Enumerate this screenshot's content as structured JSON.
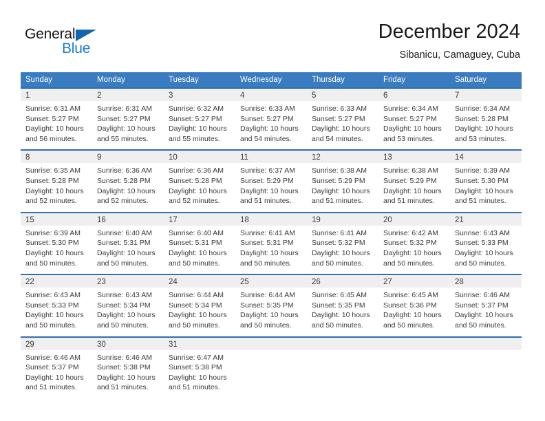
{
  "brand": {
    "name_dark": "General",
    "name_blue": "Blue",
    "accent_color": "#1a7ad4",
    "triangle_color": "#1265b0"
  },
  "header": {
    "title": "December 2024",
    "subtitle": "Sibanicu, Camaguey, Cuba"
  },
  "calendar": {
    "header_bg": "#3a7cc0",
    "row_divider_color": "#2d6fb3",
    "daynum_bg": "#efefef",
    "weekday_headers": [
      "Sunday",
      "Monday",
      "Tuesday",
      "Wednesday",
      "Thursday",
      "Friday",
      "Saturday"
    ],
    "weeks": [
      [
        {
          "day": "1",
          "sunrise": "Sunrise: 6:31 AM",
          "sunset": "Sunset: 5:27 PM",
          "daylight": "Daylight: 10 hours and 56 minutes."
        },
        {
          "day": "2",
          "sunrise": "Sunrise: 6:31 AM",
          "sunset": "Sunset: 5:27 PM",
          "daylight": "Daylight: 10 hours and 55 minutes."
        },
        {
          "day": "3",
          "sunrise": "Sunrise: 6:32 AM",
          "sunset": "Sunset: 5:27 PM",
          "daylight": "Daylight: 10 hours and 55 minutes."
        },
        {
          "day": "4",
          "sunrise": "Sunrise: 6:33 AM",
          "sunset": "Sunset: 5:27 PM",
          "daylight": "Daylight: 10 hours and 54 minutes."
        },
        {
          "day": "5",
          "sunrise": "Sunrise: 6:33 AM",
          "sunset": "Sunset: 5:27 PM",
          "daylight": "Daylight: 10 hours and 54 minutes."
        },
        {
          "day": "6",
          "sunrise": "Sunrise: 6:34 AM",
          "sunset": "Sunset: 5:27 PM",
          "daylight": "Daylight: 10 hours and 53 minutes."
        },
        {
          "day": "7",
          "sunrise": "Sunrise: 6:34 AM",
          "sunset": "Sunset: 5:28 PM",
          "daylight": "Daylight: 10 hours and 53 minutes."
        }
      ],
      [
        {
          "day": "8",
          "sunrise": "Sunrise: 6:35 AM",
          "sunset": "Sunset: 5:28 PM",
          "daylight": "Daylight: 10 hours and 52 minutes."
        },
        {
          "day": "9",
          "sunrise": "Sunrise: 6:36 AM",
          "sunset": "Sunset: 5:28 PM",
          "daylight": "Daylight: 10 hours and 52 minutes."
        },
        {
          "day": "10",
          "sunrise": "Sunrise: 6:36 AM",
          "sunset": "Sunset: 5:28 PM",
          "daylight": "Daylight: 10 hours and 52 minutes."
        },
        {
          "day": "11",
          "sunrise": "Sunrise: 6:37 AM",
          "sunset": "Sunset: 5:29 PM",
          "daylight": "Daylight: 10 hours and 51 minutes."
        },
        {
          "day": "12",
          "sunrise": "Sunrise: 6:38 AM",
          "sunset": "Sunset: 5:29 PM",
          "daylight": "Daylight: 10 hours and 51 minutes."
        },
        {
          "day": "13",
          "sunrise": "Sunrise: 6:38 AM",
          "sunset": "Sunset: 5:29 PM",
          "daylight": "Daylight: 10 hours and 51 minutes."
        },
        {
          "day": "14",
          "sunrise": "Sunrise: 6:39 AM",
          "sunset": "Sunset: 5:30 PM",
          "daylight": "Daylight: 10 hours and 51 minutes."
        }
      ],
      [
        {
          "day": "15",
          "sunrise": "Sunrise: 6:39 AM",
          "sunset": "Sunset: 5:30 PM",
          "daylight": "Daylight: 10 hours and 50 minutes."
        },
        {
          "day": "16",
          "sunrise": "Sunrise: 6:40 AM",
          "sunset": "Sunset: 5:31 PM",
          "daylight": "Daylight: 10 hours and 50 minutes."
        },
        {
          "day": "17",
          "sunrise": "Sunrise: 6:40 AM",
          "sunset": "Sunset: 5:31 PM",
          "daylight": "Daylight: 10 hours and 50 minutes."
        },
        {
          "day": "18",
          "sunrise": "Sunrise: 6:41 AM",
          "sunset": "Sunset: 5:31 PM",
          "daylight": "Daylight: 10 hours and 50 minutes."
        },
        {
          "day": "19",
          "sunrise": "Sunrise: 6:41 AM",
          "sunset": "Sunset: 5:32 PM",
          "daylight": "Daylight: 10 hours and 50 minutes."
        },
        {
          "day": "20",
          "sunrise": "Sunrise: 6:42 AM",
          "sunset": "Sunset: 5:32 PM",
          "daylight": "Daylight: 10 hours and 50 minutes."
        },
        {
          "day": "21",
          "sunrise": "Sunrise: 6:43 AM",
          "sunset": "Sunset: 5:33 PM",
          "daylight": "Daylight: 10 hours and 50 minutes."
        }
      ],
      [
        {
          "day": "22",
          "sunrise": "Sunrise: 6:43 AM",
          "sunset": "Sunset: 5:33 PM",
          "daylight": "Daylight: 10 hours and 50 minutes."
        },
        {
          "day": "23",
          "sunrise": "Sunrise: 6:43 AM",
          "sunset": "Sunset: 5:34 PM",
          "daylight": "Daylight: 10 hours and 50 minutes."
        },
        {
          "day": "24",
          "sunrise": "Sunrise: 6:44 AM",
          "sunset": "Sunset: 5:34 PM",
          "daylight": "Daylight: 10 hours and 50 minutes."
        },
        {
          "day": "25",
          "sunrise": "Sunrise: 6:44 AM",
          "sunset": "Sunset: 5:35 PM",
          "daylight": "Daylight: 10 hours and 50 minutes."
        },
        {
          "day": "26",
          "sunrise": "Sunrise: 6:45 AM",
          "sunset": "Sunset: 5:35 PM",
          "daylight": "Daylight: 10 hours and 50 minutes."
        },
        {
          "day": "27",
          "sunrise": "Sunrise: 6:45 AM",
          "sunset": "Sunset: 5:36 PM",
          "daylight": "Daylight: 10 hours and 50 minutes."
        },
        {
          "day": "28",
          "sunrise": "Sunrise: 6:46 AM",
          "sunset": "Sunset: 5:37 PM",
          "daylight": "Daylight: 10 hours and 50 minutes."
        }
      ],
      [
        {
          "day": "29",
          "sunrise": "Sunrise: 6:46 AM",
          "sunset": "Sunset: 5:37 PM",
          "daylight": "Daylight: 10 hours and 51 minutes."
        },
        {
          "day": "30",
          "sunrise": "Sunrise: 6:46 AM",
          "sunset": "Sunset: 5:38 PM",
          "daylight": "Daylight: 10 hours and 51 minutes."
        },
        {
          "day": "31",
          "sunrise": "Sunrise: 6:47 AM",
          "sunset": "Sunset: 5:38 PM",
          "daylight": "Daylight: 10 hours and 51 minutes."
        },
        {
          "day": "",
          "sunrise": "",
          "sunset": "",
          "daylight": ""
        },
        {
          "day": "",
          "sunrise": "",
          "sunset": "",
          "daylight": ""
        },
        {
          "day": "",
          "sunrise": "",
          "sunset": "",
          "daylight": ""
        },
        {
          "day": "",
          "sunrise": "",
          "sunset": "",
          "daylight": ""
        }
      ]
    ]
  }
}
